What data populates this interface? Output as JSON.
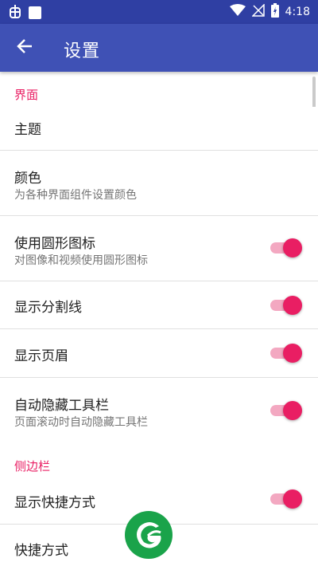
{
  "status_bar": {
    "time": "4:18",
    "icons": [
      "bug-icon",
      "square-notification-icon",
      "wifi-icon",
      "no-signal-icon",
      "battery-charging-icon"
    ]
  },
  "app_bar": {
    "title": "设置",
    "back_icon": "arrow-back-icon"
  },
  "sections": {
    "interface": {
      "header": "界面"
    },
    "sidebar": {
      "header": "侧边栏"
    }
  },
  "prefs": {
    "theme": {
      "title": "主题"
    },
    "color": {
      "title": "颜色",
      "summary": "为各种界面组件设置颜色"
    },
    "round_icons": {
      "title": "使用圆形图标",
      "summary": "对图像和视频使用圆形图标",
      "checked": true
    },
    "dividers": {
      "title": "显示分割线",
      "checked": true
    },
    "header": {
      "title": "显示页眉",
      "checked": true
    },
    "auto_hide_toolbar": {
      "title": "自动隐藏工具栏",
      "summary": "页面滚动时自动隐藏工具栏",
      "checked": true
    },
    "show_shortcuts": {
      "title": "显示快捷方式",
      "checked": true
    },
    "shortcuts": {
      "title": "快捷方式"
    }
  },
  "colors": {
    "primary": "#3f51b5",
    "primary_dark": "#2f3fa3",
    "accent": "#e91e63",
    "logo_green": "#1aa34a"
  }
}
